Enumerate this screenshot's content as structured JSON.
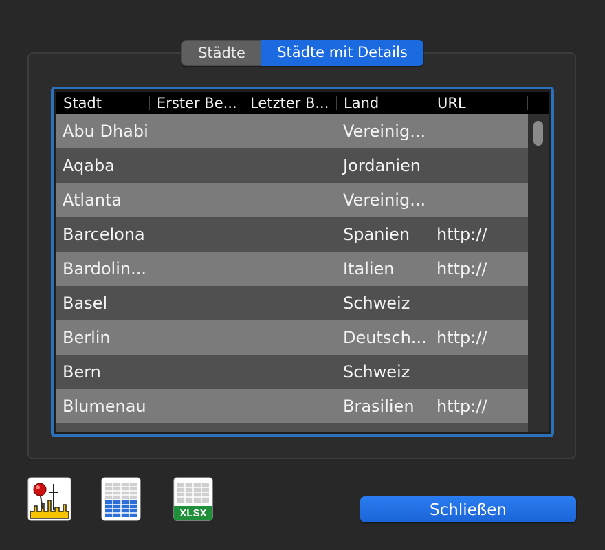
{
  "tabs": {
    "cities": "Städte",
    "cities_details": "Städte mit Details",
    "selected": "Städte mit Details"
  },
  "table": {
    "columns": [
      "Stadt",
      "Erster Be...",
      "Letzter B...",
      "Land",
      "URL"
    ],
    "rows": [
      [
        "Abu Dhabi",
        "",
        "",
        "Vereinig...",
        ""
      ],
      [
        "Aqaba",
        "",
        "",
        "Jordanien",
        ""
      ],
      [
        "Atlanta",
        "",
        "",
        "Vereinig...",
        ""
      ],
      [
        "Barcelona",
        "",
        "",
        "Spanien",
        "http://"
      ],
      [
        "Bardolin...",
        "",
        "",
        "Italien",
        "http://"
      ],
      [
        "Basel",
        "",
        "",
        "Schweiz",
        ""
      ],
      [
        "Berlin",
        "",
        "",
        "Deutsch...",
        "http://"
      ],
      [
        "Bern",
        "",
        "",
        "Schweiz",
        ""
      ],
      [
        "Blumenau",
        "",
        "",
        "Brasilien",
        "http://"
      ]
    ]
  },
  "toolbar": {
    "map_icon": "map-pin-city-icon",
    "table_icon": "table-export-icon",
    "xlsx_icon": "xlsx-export-icon",
    "xlsx_label": "XLSX"
  },
  "buttons": {
    "close": "Schließen"
  },
  "colors": {
    "accent": "#1c6ae0",
    "table_border": "#2b70b8",
    "row_light": "#7b7b7b",
    "row_dark": "#505050"
  }
}
